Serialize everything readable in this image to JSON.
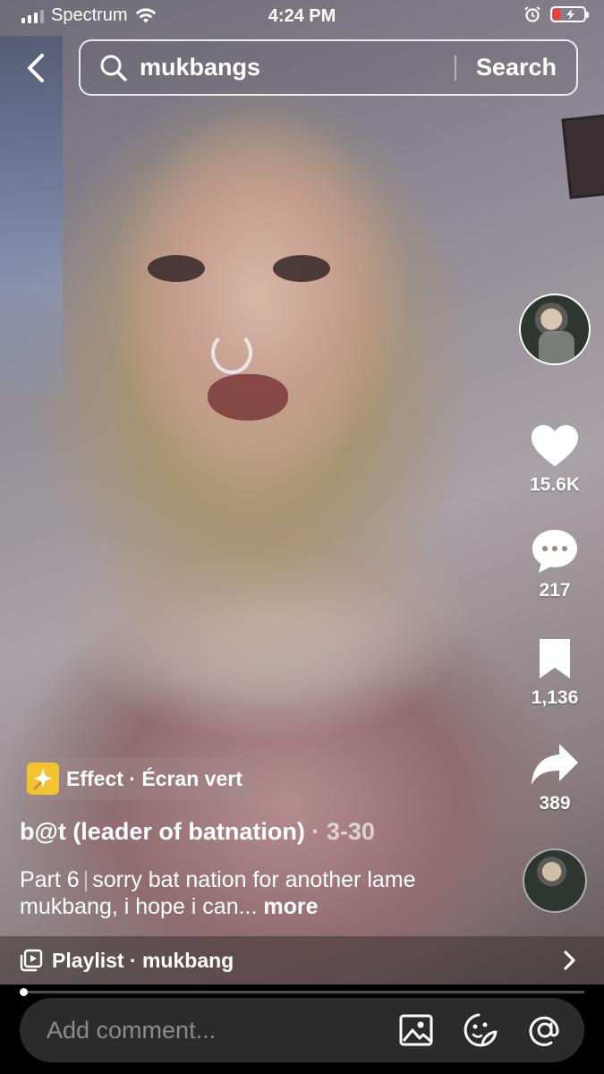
{
  "status_bar": {
    "carrier": "Spectrum",
    "time": "4:24 PM",
    "battery_level": 0.15,
    "battery_color": "#ff3b30"
  },
  "search": {
    "query": "mukbangs",
    "button_label": "Search"
  },
  "actions": {
    "likes": "15.6K",
    "comments": "217",
    "saves": "1,136",
    "shares": "389"
  },
  "effect": {
    "label": "Effect · Écran vert"
  },
  "post": {
    "author": "b@t (leader of batnation)",
    "date": " · 3-30",
    "part": "Part 6",
    "separator": "|",
    "caption": "sorry bat nation for another lame mukbang, i hope i can...",
    "more_label": "more"
  },
  "playlist": {
    "label": "Playlist · mukbang"
  },
  "comment_bar": {
    "placeholder": "Add comment..."
  },
  "icons": [
    "back-chevron-icon",
    "search-icon",
    "heart-icon",
    "comment-bubble-icon",
    "bookmark-icon",
    "share-arrow-icon",
    "playlist-icon",
    "chevron-right-icon",
    "image-icon",
    "emoji-icon",
    "mention-icon"
  ]
}
